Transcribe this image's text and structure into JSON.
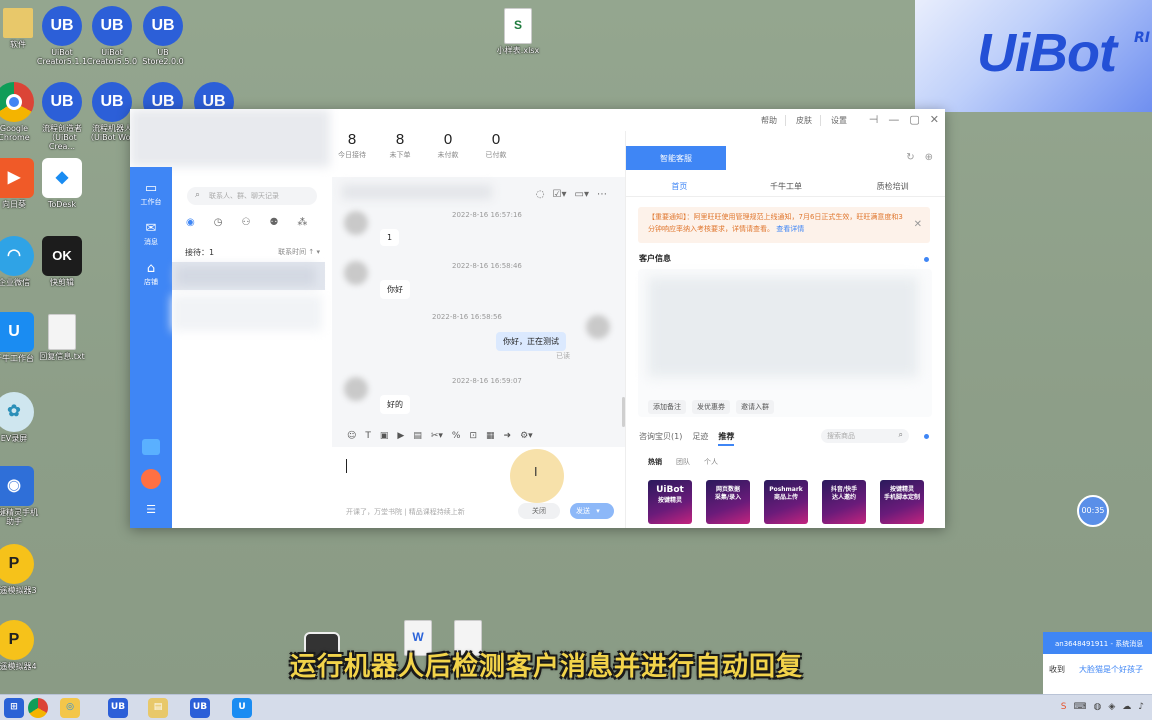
{
  "desktop": {
    "icons": [
      {
        "label": "软件",
        "glyph": "",
        "kind": "file"
      },
      {
        "label": "UiBot Creator5.1.1",
        "glyph": "UB",
        "kind": "ub"
      },
      {
        "label": "UiBot Creator5.5.0",
        "glyph": "UB",
        "kind": "ub"
      },
      {
        "label": "UB Store2.0.0",
        "glyph": "UB",
        "kind": "ub"
      },
      {
        "label": "Google Chrome",
        "glyph": "",
        "kind": "chrome"
      },
      {
        "label": "流程创造者（UiBot Crea...",
        "glyph": "UB",
        "kind": "ub"
      },
      {
        "label": "流程机器人（UiBot Wo...",
        "glyph": "UB",
        "kind": "ub"
      },
      {
        "label": "",
        "glyph": "UB",
        "kind": "ub"
      },
      {
        "label": "",
        "glyph": "UB",
        "kind": "ub"
      },
      {
        "label": "向日葵",
        "glyph": "",
        "kind": "sunlogin"
      },
      {
        "label": "ToDesk",
        "glyph": "",
        "kind": "todesk"
      },
      {
        "label": "企业微信",
        "glyph": "",
        "kind": "wecom"
      },
      {
        "label": "快剪辑",
        "glyph": "OK",
        "kind": "kjj"
      },
      {
        "label": "千牛工作台",
        "glyph": "U",
        "kind": "qianniu"
      },
      {
        "label": "回复信息.txt",
        "glyph": "",
        "kind": "txt"
      },
      {
        "label": "EV录屏",
        "glyph": "",
        "kind": "ev"
      },
      {
        "label": "按键精灵手机助手",
        "glyph": "",
        "kind": "ajjl"
      },
      {
        "label": "逍遥模拟器3",
        "glyph": "",
        "kind": "xy"
      },
      {
        "label": "逍遥模拟器4",
        "glyph": "",
        "kind": "xy"
      },
      {
        "label": "小样表.xlsx",
        "glyph": "S",
        "kind": "xls"
      }
    ],
    "brand_logo": "UiBot",
    "brand_mark": "RI"
  },
  "window": {
    "title_links": [
      "帮助",
      "皮肤",
      "设置"
    ],
    "controls": [
      "⊣",
      "—",
      "▢",
      "✕"
    ],
    "stats": [
      {
        "value": "8",
        "label": "今日接待"
      },
      {
        "value": "8",
        "label": "未下单"
      },
      {
        "value": "0",
        "label": "未付款"
      },
      {
        "value": "0",
        "label": "已付款"
      }
    ],
    "sidebar": [
      {
        "icon": "▭",
        "label": "工作台"
      },
      {
        "icon": "✉",
        "label": "消息"
      },
      {
        "icon": "⌂",
        "label": "店铺"
      }
    ],
    "sidebar_bottom": [
      "☰"
    ],
    "contacts": {
      "search_placeholder": "联系人、群、聊天记录",
      "receiving": "接待：1",
      "sort": "联系时间 ↑ ▾"
    },
    "chat": {
      "messages": [
        {
          "time": "2022-8-16 16:57:16",
          "text": "1",
          "from": "customer"
        },
        {
          "time": "2022-8-16 16:58:46",
          "text": "你好",
          "from": "customer"
        },
        {
          "time": "2022-8-16 16:58:56",
          "text": "你好，正在测试",
          "from": "me",
          "status": "已读"
        },
        {
          "time": "2022-8-16 16:59:07",
          "text": "好的",
          "from": "customer"
        }
      ],
      "footer_note": "开课了，万堂书院 | 精品课程持续上新",
      "close_label": "关闭",
      "send_label": "发送",
      "send_arrow": "▾"
    },
    "right": {
      "active_tab": "智能客服",
      "subtabs": [
        "首页",
        "千牛工单",
        "质检培训"
      ],
      "notice_text": "【重要通知】：阿里旺旺使用管理规范上线通知，7月6日正式生效，旺旺满意度和3分钟响应率纳入考核要求，详情请查看。",
      "notice_link": "查看详情",
      "customer_info_title": "客户信息",
      "tags": [
        "添加备注",
        "发优惠券",
        "邀请入群"
      ],
      "product_tabs": [
        "咨询宝贝(1)",
        "足迹",
        "推荐"
      ],
      "product_search_placeholder": "搜索商品",
      "filters": [
        "热销",
        "团队",
        "个人"
      ],
      "products": [
        {
          "line1": "UiBot",
          "line2": "按键精灵"
        },
        {
          "line1": "网页数据",
          "line2": "采集/录入"
        },
        {
          "line1": "Poshmark",
          "line2": "商品上传"
        },
        {
          "line1": "抖音/快手",
          "line2": "达人邀约"
        },
        {
          "line1": "按键精灵",
          "line2": "手机脚本定制"
        }
      ]
    }
  },
  "timer": "00:35",
  "notification": {
    "header": "an3648491911 - 系统消息",
    "action": "收到",
    "text": "大脸猫是个好孩子"
  },
  "subtitle": "运行机器人后检测客户消息并进行自动回复"
}
